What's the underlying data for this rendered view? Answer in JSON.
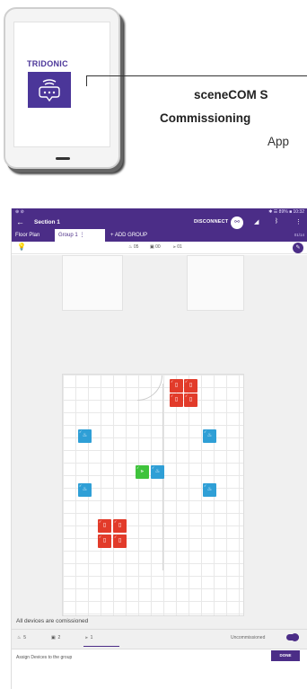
{
  "promo": {
    "brand": "TRIDONIC",
    "title": "sceneCOM S",
    "subtitle": "Commissioning",
    "app_label": "App"
  },
  "status_bar": {
    "left": "⊕ ⊘",
    "right": "✱ ☰ 89% ■ 10:32"
  },
  "app_bar": {
    "title": "Section 1",
    "disconnect_label": "DISCONNECT"
  },
  "tabs": {
    "floor_plan": "Floor Plan",
    "group": "Group 1",
    "add_group": "+ ADD GROUP",
    "counter": "01/14"
  },
  "toolbar": {
    "sensors_count": "05",
    "switches_count": "00",
    "drivers_count": "01"
  },
  "footer": {
    "message": "All devices are comissioned",
    "sensors": "5",
    "switches": "2",
    "drivers": "1",
    "uncommissioned_label": "Uncommissioned",
    "assign_label": "Assign Devices to the group",
    "done_label": "DONE"
  },
  "colors": {
    "brand_purple": "#4b2d87",
    "sensor_blue": "#2f9fd6",
    "driver_red": "#e23b2a",
    "active_green": "#3fc33c"
  }
}
